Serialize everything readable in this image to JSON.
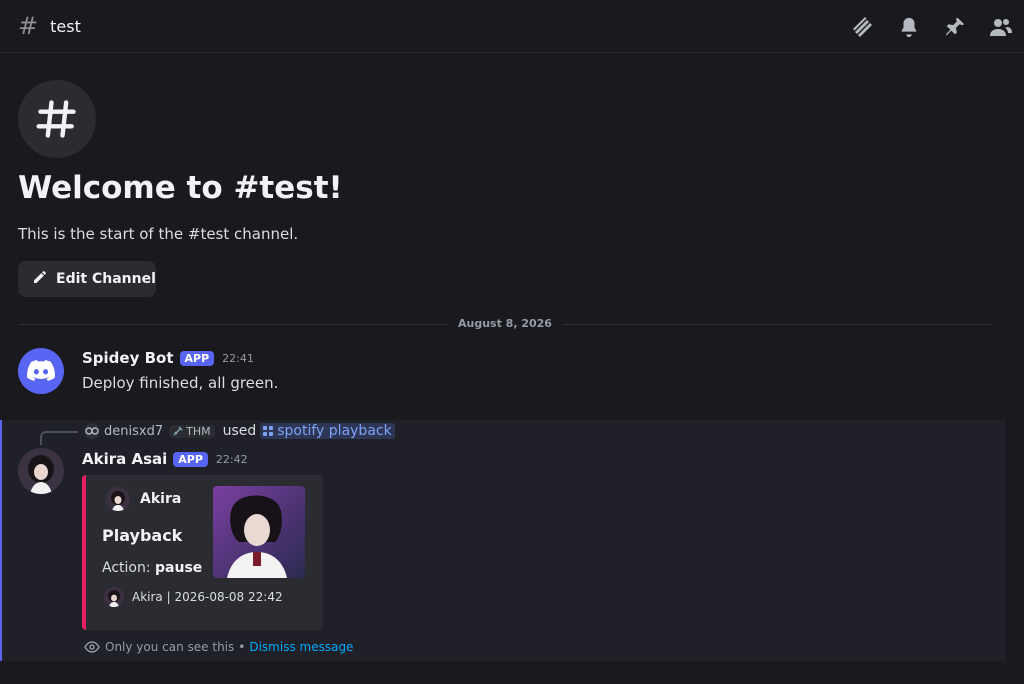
{
  "header": {
    "channel_name": "test",
    "icons": [
      "threads-icon",
      "bell-icon",
      "pin-icon",
      "members-icon"
    ]
  },
  "welcome": {
    "title": "Welcome to #test!",
    "subtitle": "This is the start of the #test channel.",
    "edit_button": "Edit Channel"
  },
  "date_divider": "August 8, 2026",
  "messages": [
    {
      "author": "Spidey Bot",
      "badge": "APP",
      "time": "22:41",
      "text": "Deploy finished, all green."
    },
    {
      "author": "Akira Asai",
      "badge": "APP",
      "time": "22:42",
      "interaction": {
        "user": "denisxd7",
        "tag": "THM",
        "used_label": "used",
        "command": "spotify playback"
      },
      "embed": {
        "author": "Akira",
        "title": "Playback",
        "field_label": "Action:",
        "field_value": "pause",
        "footer": "Akira | 2026-08-08 22:42",
        "color": "#e91e63"
      },
      "ephemeral": {
        "notice": "Only you can see this",
        "separator": "•",
        "dismiss": "Dismiss message"
      }
    }
  ],
  "colors": {
    "background": "#1a1a1e",
    "accent": "#5865f2",
    "link": "#00a8fc"
  }
}
